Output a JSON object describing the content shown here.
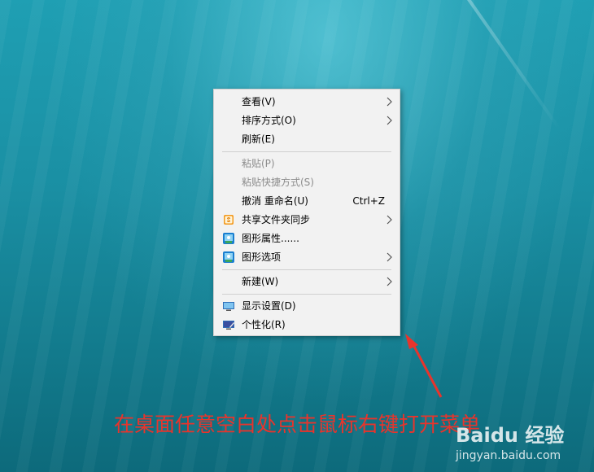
{
  "menu": {
    "items": [
      {
        "label": "查看(V)",
        "submenu": true
      },
      {
        "label": "排序方式(O)",
        "submenu": true
      },
      {
        "label": "刷新(E)"
      },
      {
        "label": "粘贴(P)",
        "disabled": true
      },
      {
        "label": "粘贴快捷方式(S)",
        "disabled": true
      },
      {
        "label": "撤消 重命名(U)",
        "shortcut": "Ctrl+Z"
      },
      {
        "label": "共享文件夹同步",
        "submenu": true,
        "icon": "sync-app-icon"
      },
      {
        "label": "图形属性......",
        "icon": "graphics-properties-icon"
      },
      {
        "label": "图形选项",
        "submenu": true,
        "icon": "graphics-options-icon"
      },
      {
        "label": "新建(W)",
        "submenu": true
      },
      {
        "label": "显示设置(D)",
        "icon": "display-settings-icon"
      },
      {
        "label": "个性化(R)",
        "icon": "personalize-icon"
      }
    ]
  },
  "annotation": {
    "caption": "在桌面任意空白处点击鼠标右键打开菜单"
  },
  "watermark": {
    "logo": "Baidu 经验",
    "url": "jingyan.baidu.com"
  },
  "colors": {
    "caption": "#e8342c",
    "menu_bg": "#f2f2f2"
  }
}
